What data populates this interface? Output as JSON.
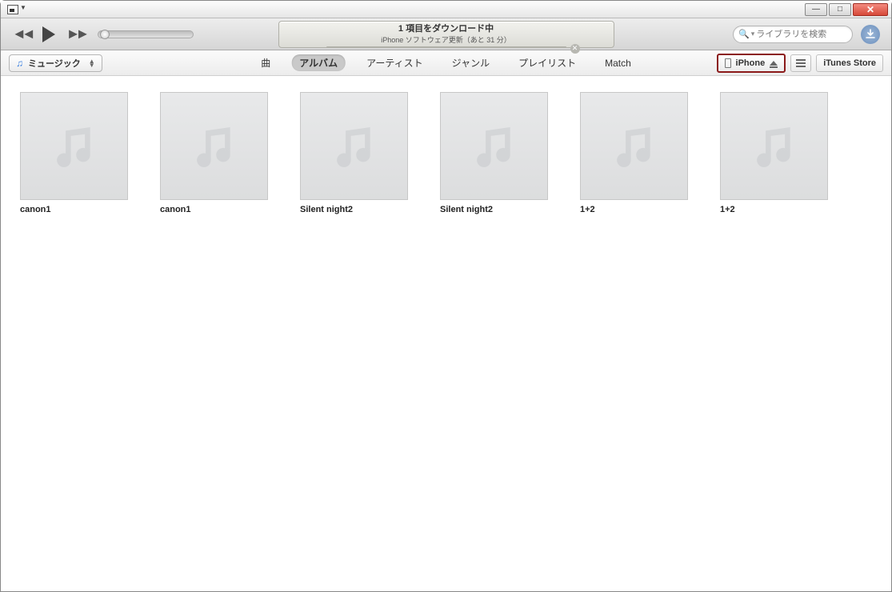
{
  "lcd": {
    "title": "1 項目をダウンロード中",
    "subtitle": "iPhone ソフトウェア更新（あと 31 分）"
  },
  "search": {
    "placeholder": "ライブラリを検索"
  },
  "library_selector": {
    "label": "ミュージック"
  },
  "view_tabs": [
    {
      "label": "曲",
      "active": false
    },
    {
      "label": "アルバム",
      "active": true
    },
    {
      "label": "アーティスト",
      "active": false
    },
    {
      "label": "ジャンル",
      "active": false
    },
    {
      "label": "プレイリスト",
      "active": false
    },
    {
      "label": "Match",
      "active": false
    }
  ],
  "device_button": {
    "label": "iPhone"
  },
  "store_button": {
    "label": "iTunes Store"
  },
  "albums": [
    {
      "title": "canon1"
    },
    {
      "title": "canon1"
    },
    {
      "title": "Silent night2"
    },
    {
      "title": "Silent night2"
    },
    {
      "title": "1+2"
    },
    {
      "title": "1+2"
    }
  ]
}
